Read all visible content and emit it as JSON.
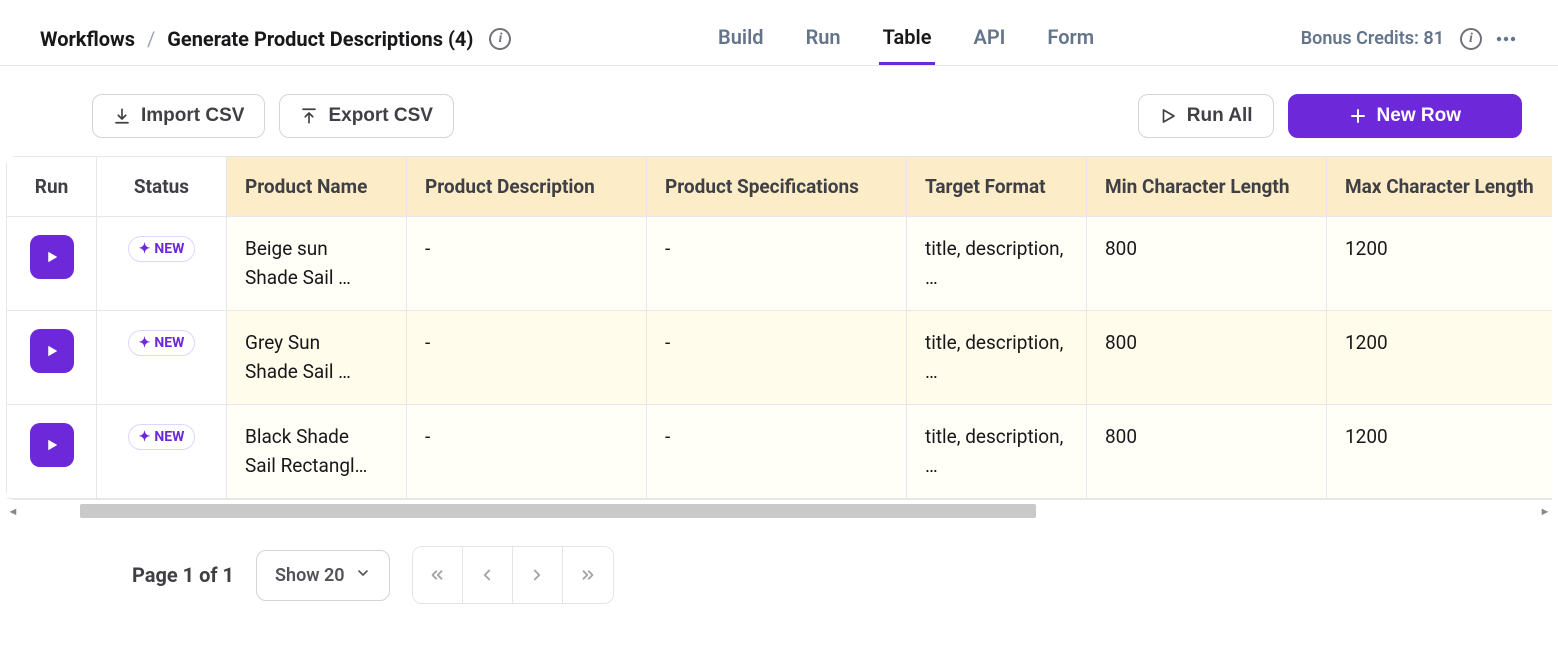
{
  "breadcrumb": {
    "root": "Workflows",
    "current": "Generate Product Descriptions (4)"
  },
  "tabs": [
    {
      "label": "Build",
      "active": false
    },
    {
      "label": "Run",
      "active": false
    },
    {
      "label": "Table",
      "active": true
    },
    {
      "label": "API",
      "active": false
    },
    {
      "label": "Form",
      "active": false
    }
  ],
  "credits_label": "Bonus Credits: 81",
  "toolbar": {
    "import_label": "Import CSV",
    "export_label": "Export CSV",
    "run_all_label": "Run All",
    "new_row_label": "New Row"
  },
  "columns": [
    {
      "label": "Run",
      "class": "col-run",
      "highlight": false
    },
    {
      "label": "Status",
      "class": "col-status",
      "highlight": false
    },
    {
      "label": "Product Name",
      "class": "col-name",
      "highlight": true
    },
    {
      "label": "Product Description",
      "class": "col-desc",
      "highlight": true
    },
    {
      "label": "Product Specifications",
      "class": "col-spec",
      "highlight": true
    },
    {
      "label": "Target Format",
      "class": "col-fmt",
      "highlight": true
    },
    {
      "label": "Min Character Length",
      "class": "col-min",
      "highlight": true
    },
    {
      "label": "Max Character Length",
      "class": "col-max",
      "highlight": true
    }
  ],
  "status_badge_label": "NEW",
  "rows": [
    {
      "product_name": "Beige sun Shade Sail …",
      "product_description": "-",
      "product_specifications": "-",
      "target_format": "title, description, …",
      "min_len": "800",
      "max_len": "1200"
    },
    {
      "product_name": "Grey Sun Shade Sail …",
      "product_description": "-",
      "product_specifications": "-",
      "target_format": "title, description, …",
      "min_len": "800",
      "max_len": "1200"
    },
    {
      "product_name": "Black Shade Sail Rectangl…",
      "product_description": "-",
      "product_specifications": "-",
      "target_format": "title, description, …",
      "min_len": "800",
      "max_len": "1200"
    }
  ],
  "pagination": {
    "label": "Page 1 of 1",
    "show_label": "Show 20"
  }
}
